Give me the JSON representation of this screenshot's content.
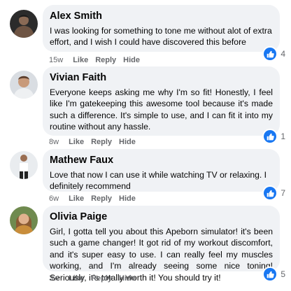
{
  "actions": {
    "like": "Like",
    "reply": "Reply",
    "hide": "Hide"
  },
  "colors": {
    "bubble": "#f0f2f5",
    "like_blue": "#1877f2",
    "meta_gray": "#65676b"
  },
  "comments": [
    {
      "author": "Alex Smith",
      "text": "I was looking for something to tone me without alot of extra effort, and I wish I could have discovered this before",
      "time": "15w",
      "likes": "4",
      "avatar_icon": "person-dark-portrait-icon"
    },
    {
      "author": "Vivian Faith",
      "text": "Everyone keeps asking me why I'm so fit! Honestly, I feel like I'm gatekeeping this awesome tool because it's made such a difference. It's simple to use, and I can fit it into my routine without any hassle.",
      "time": "8w",
      "likes": "1",
      "avatar_icon": "person-portrait-icon"
    },
    {
      "author": "Mathew Faux",
      "text": "Love that now I can use it while watching TV or relaxing. I definitely recommend",
      "time": "6w",
      "likes": "7",
      "avatar_icon": "person-full-body-icon"
    },
    {
      "author": "Olivia Paige",
      "text": "Girl, I gotta tell you about this Apeborn simulator! it's been such a game changer! It got rid of my workout discomfort, and it's super easy to use. I can really feel my muscles working, and I'm already seeing some nice toning! Seriously, it's totally worth it! You should try it!",
      "time": "3w",
      "likes": "5",
      "avatar_icon": "person-woman-portrait-icon"
    }
  ]
}
